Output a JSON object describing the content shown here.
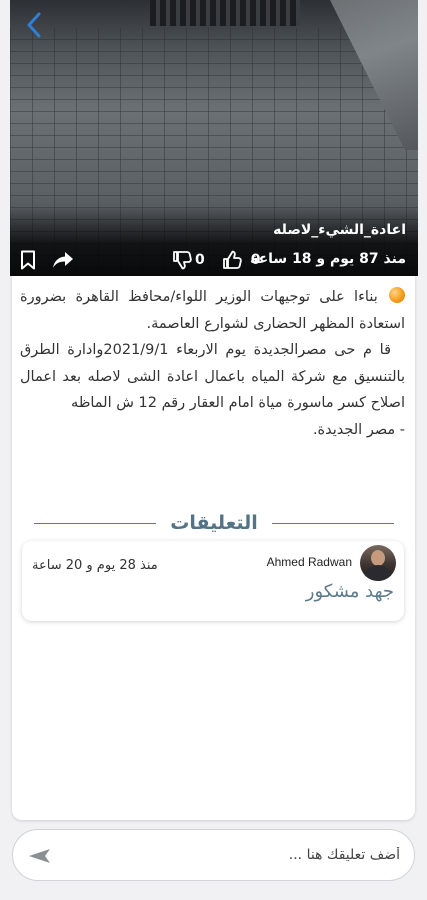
{
  "post": {
    "title": "اعادة_الشيء_لاصله",
    "time_ago": "منذ 87 يوم و 18 ساعة",
    "likes": "0",
    "dislikes": "0",
    "body": [
      "بناءا على توجيهات الوزير اللواء/محافظ القاهرة بضرورة استعادة المظهر الحضارى لشوارع العاصمة.",
      "قا م حى مصرالجديدة يوم الاربعاء 2021/9/1وادارة الطرق بالتنسيق مع شركة المياه باعمال اعادة الشى لاصله بعد اعمال اصلاح كسر ماسورة مياة امام العقار رقم 12 ش الماظه",
      "- مصر الجديدة."
    ]
  },
  "comments": {
    "heading": "التعليقات",
    "items": [
      {
        "author": "Ahmed Radwan",
        "time_ago": "منذ 28 يوم و 20 ساعة",
        "text": "جهد مشكور"
      }
    ]
  },
  "input": {
    "placeholder": "أضف تعليقك هنا ..."
  },
  "icons": {
    "back": "chevron-left-icon",
    "bookmark": "bookmark-icon",
    "share": "share-icon",
    "dislike": "thumbs-down-icon",
    "like": "thumbs-up-icon",
    "send": "send-icon",
    "bullet": "orange-circle-icon"
  },
  "colors": {
    "accent": "#547486",
    "back_icon": "#2f7fd6",
    "bullet": "#f59d1a"
  }
}
